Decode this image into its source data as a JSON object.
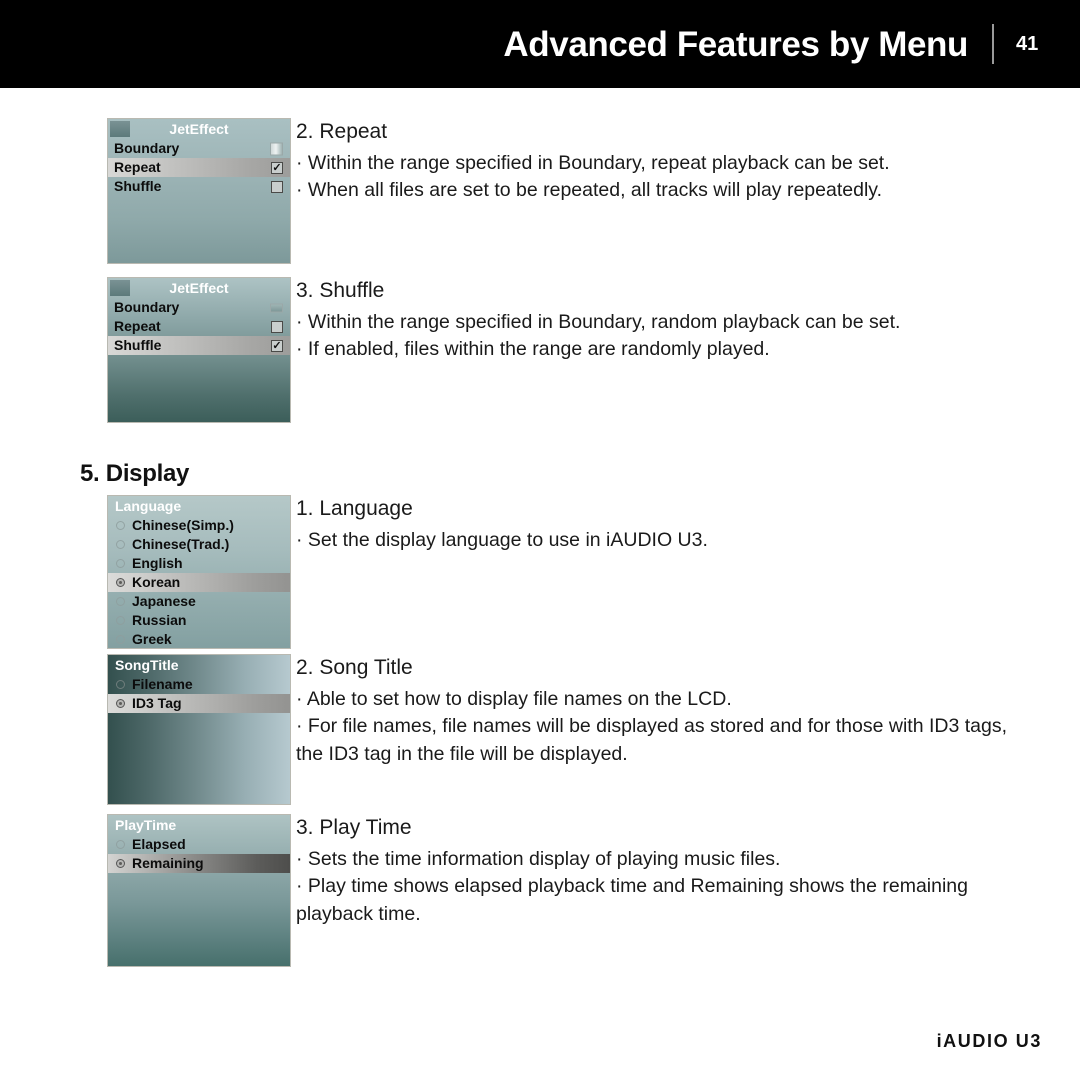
{
  "header": {
    "title": "Advanced Features by Menu",
    "page_number": "41"
  },
  "footer": {
    "brand": "iAUDIO U3"
  },
  "sections": [
    {
      "id": "repeat",
      "heading": "2. Repeat",
      "bullets": [
        "· Within the range specified in Boundary, repeat playback can be set.",
        "· When all files are set to be repeated, all tracks will play repeatedly."
      ],
      "lcd": {
        "title": "JetEffect",
        "rows": [
          {
            "label": "Boundary",
            "widget": "valuebox",
            "selected": false
          },
          {
            "label": "Repeat",
            "widget": "checkbox-checked",
            "selected": true
          },
          {
            "label": "Shuffle",
            "widget": "checkbox-empty",
            "selected": false
          }
        ]
      }
    },
    {
      "id": "shuffle",
      "heading": "3. Shuffle",
      "bullets": [
        "· Within the range specified in Boundary, random playback can be set.",
        "· If enabled, files within the range are randomly played."
      ],
      "lcd": {
        "title": "JetEffect",
        "rows": [
          {
            "label": "Boundary",
            "widget": "valuebox-flat",
            "selected": false
          },
          {
            "label": "Repeat",
            "widget": "checkbox-empty",
            "selected": false
          },
          {
            "label": "Shuffle",
            "widget": "checkbox-checked",
            "selected": true
          }
        ]
      }
    },
    {
      "id": "language",
      "heading": "1. Language",
      "bullets": [
        "· Set the display language to use in iAUDIO U3."
      ],
      "lcd": {
        "title": "Language",
        "rows": [
          {
            "label": "Chinese(Simp.)",
            "widget": "radio-off",
            "selected": false
          },
          {
            "label": "Chinese(Trad.)",
            "widget": "radio-off",
            "selected": false
          },
          {
            "label": "English",
            "widget": "radio-off",
            "selected": false
          },
          {
            "label": "Korean",
            "widget": "radio-on",
            "selected": true
          },
          {
            "label": "Japanese",
            "widget": "radio-off",
            "selected": false
          },
          {
            "label": "Russian",
            "widget": "radio-off",
            "selected": false
          },
          {
            "label": "Greek",
            "widget": "radio-off",
            "selected": false
          }
        ]
      }
    },
    {
      "id": "song-title",
      "heading": "2. Song Title",
      "bullets": [
        "· Able to set how to display file names on the LCD.",
        "· For file names, file names will be displayed as stored and for those with ID3 tags,",
        "the ID3 tag in the file will be displayed."
      ],
      "lcd": {
        "title": "SongTitle",
        "rows": [
          {
            "label": "Filename",
            "widget": "radio-off",
            "selected": false
          },
          {
            "label": "ID3 Tag",
            "widget": "radio-on",
            "selected": true
          }
        ]
      }
    },
    {
      "id": "play-time",
      "heading": "3. Play Time",
      "bullets": [
        "· Sets the time information display of playing music files.",
        "· Play time shows elapsed playback time and Remaining shows the remaining",
        "playback time."
      ],
      "lcd": {
        "title": "PlayTime",
        "rows": [
          {
            "label": "Elapsed",
            "widget": "radio-off",
            "selected": false
          },
          {
            "label": "Remaining",
            "widget": "radio-on",
            "selected": true
          }
        ]
      }
    }
  ],
  "display_section": {
    "title": "5. Display"
  },
  "colors": {
    "header_bg": "#000000",
    "header_text": "#ffffff",
    "body_text": "#1a1a1a",
    "lcd_border": "#b9b9b1",
    "lcd_title_text": "#ffffff",
    "highlight_grey": "#c2c2c0"
  }
}
